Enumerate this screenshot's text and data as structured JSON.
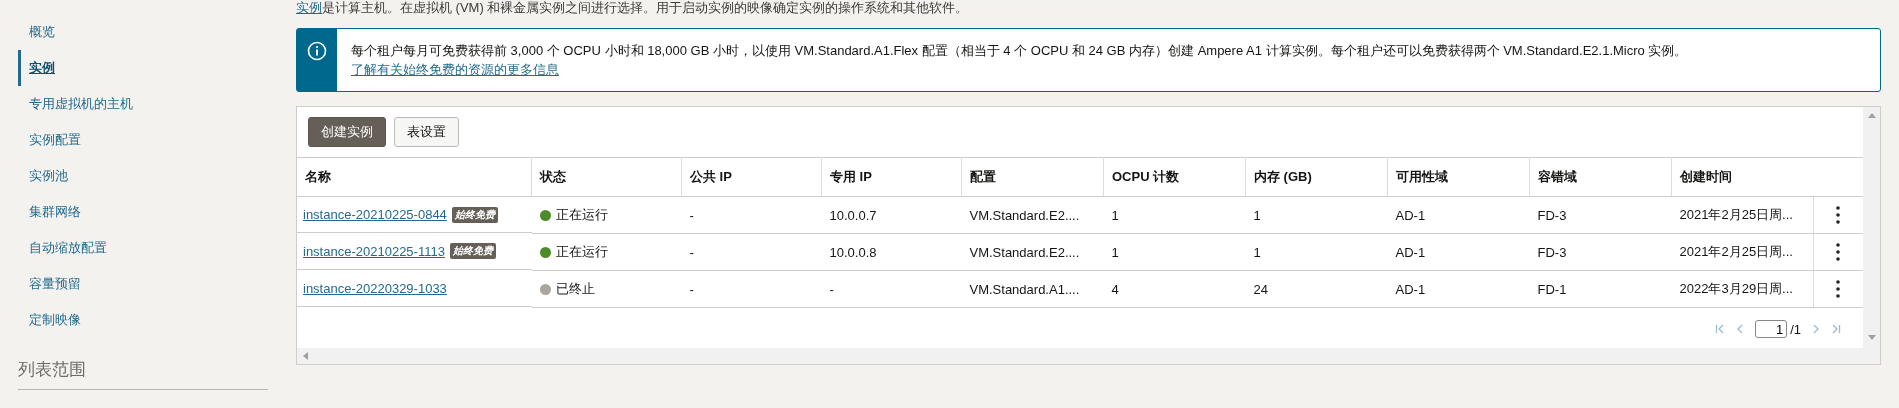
{
  "intro": {
    "link": "实例",
    "text": "是计算主机。在虚拟机 (VM) 和裸金属实例之间进行选择。用于启动实例的映像确定实例的操作系统和其他软件。"
  },
  "sidebar": {
    "items": [
      {
        "label": "概览",
        "selected": false
      },
      {
        "label": "实例",
        "selected": true
      },
      {
        "label": "专用虚拟机的主机",
        "selected": false
      },
      {
        "label": "实例配置",
        "selected": false
      },
      {
        "label": "实例池",
        "selected": false
      },
      {
        "label": "集群网络",
        "selected": false
      },
      {
        "label": "自动缩放配置",
        "selected": false
      },
      {
        "label": "容量预留",
        "selected": false
      },
      {
        "label": "定制映像",
        "selected": false
      }
    ],
    "section_title": "列表范围"
  },
  "info": {
    "text": "每个租户每月可免费获得前 3,000 个 OCPU 小时和 18,000 GB 小时，以使用 VM.Standard.A1.Flex 配置（相当于 4 个 OCPU 和 24 GB 内存）创建 Ampere A1 计算实例。每个租户还可以免费获得两个 VM.Standard.E2.1.Micro 实例。",
    "link": "了解有关始终免费的资源的更多信息"
  },
  "toolbar": {
    "buttons": [
      {
        "label": "创建实例",
        "kind": "primary"
      },
      {
        "label": "表设置",
        "kind": "secondary"
      }
    ]
  },
  "table": {
    "columns": [
      "名称",
      "状态",
      "公共 IP",
      "专用 IP",
      "配置",
      "OCPU 计数",
      "内存 (GB)",
      "可用性域",
      "容错域",
      "创建时间"
    ],
    "rows": [
      {
        "name": "instance-20210225-0844",
        "badge": "始终免费",
        "status": "正在运行",
        "color": "#4f8a2b",
        "public_ip": "-",
        "private_ip": "10.0.0.7",
        "shape": "VM.Standard.E2....",
        "ocpu": "1",
        "memory": "1",
        "ad": "AD-1",
        "fd": "FD-3",
        "created": "2021年2月25日周..."
      },
      {
        "name": "instance-20210225-1113",
        "badge": "始终免费",
        "status": "正在运行",
        "color": "#4f8a2b",
        "public_ip": "-",
        "private_ip": "10.0.0.8",
        "shape": "VM.Standard.E2....",
        "ocpu": "1",
        "memory": "1",
        "ad": "AD-1",
        "fd": "FD-3",
        "created": "2021年2月25日周..."
      },
      {
        "name": "instance-20220329-1033",
        "status": "已终止",
        "color": "#aaa69f",
        "public_ip": "-",
        "private_ip": "-",
        "shape": "VM.Standard.A1....",
        "ocpu": "4",
        "memory": "24",
        "ad": "AD-1",
        "fd": "FD-1",
        "created": "2022年3月29日周..."
      }
    ]
  },
  "pagination": {
    "page": "1",
    "total": "/1"
  }
}
